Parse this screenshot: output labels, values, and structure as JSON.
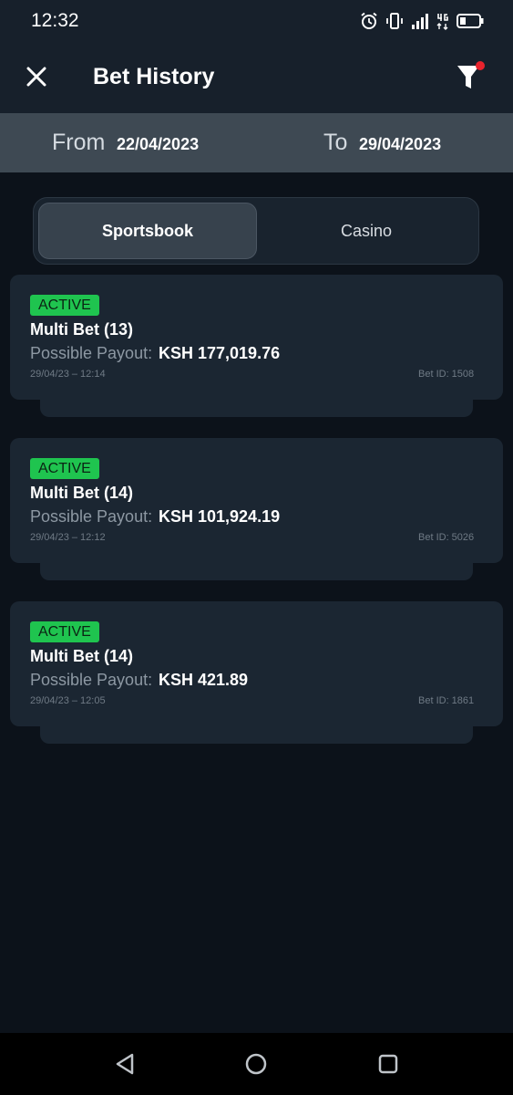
{
  "status_bar": {
    "time": "12:32"
  },
  "header": {
    "title": "Bet History",
    "filter_active": true
  },
  "date_range": {
    "from_label": "From",
    "from_value": "22/04/2023",
    "to_label": "To",
    "to_value": "29/04/2023"
  },
  "tabs": [
    {
      "label": "Sportsbook",
      "selected": true
    },
    {
      "label": "Casino",
      "selected": false
    }
  ],
  "bets": [
    {
      "status": "ACTIVE",
      "type": "Multi Bet (13)",
      "payout_label": "Possible Payout:",
      "payout_value": "KSH 177,019.76",
      "datetime": "29/04/23 – 12:14",
      "bet_id": "Bet ID: 1508"
    },
    {
      "status": "ACTIVE",
      "type": "Multi Bet (14)",
      "payout_label": "Possible Payout:",
      "payout_value": "KSH 101,924.19",
      "datetime": "29/04/23 – 12:12",
      "bet_id": "Bet ID: 5026"
    },
    {
      "status": "ACTIVE",
      "type": "Multi Bet (14)",
      "payout_label": "Possible Payout:",
      "payout_value": "KSH 421.89",
      "datetime": "29/04/23 – 12:05",
      "bet_id": "Bet ID: 1861"
    }
  ],
  "colors": {
    "background": "#0c121a",
    "header": "#17202b",
    "date_bar": "#3e4953",
    "card": "#1b2632",
    "active_badge": "#1fc44f",
    "filter_dot": "#e8232d"
  },
  "icons": {
    "close": "close-icon",
    "filter": "filter-icon",
    "nav_back": "back-triangle-icon",
    "nav_home": "home-circle-icon",
    "nav_recents": "recents-square-icon"
  }
}
